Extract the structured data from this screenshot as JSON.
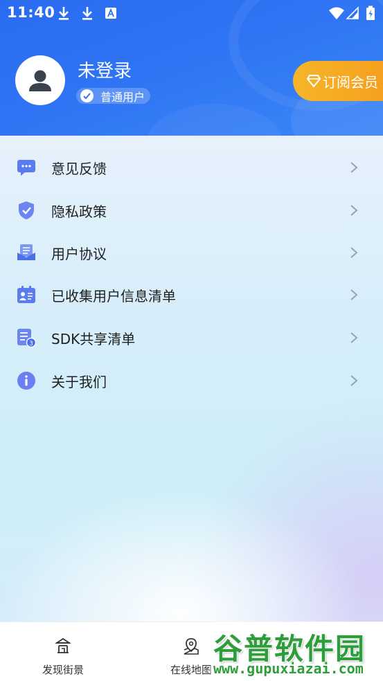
{
  "status_bar": {
    "time": "11:40",
    "icons": [
      "download-icon",
      "download-icon",
      "a-notification-icon",
      "wifi-icon",
      "signal-icon",
      "battery-icon"
    ]
  },
  "profile": {
    "name": "未登录",
    "badge": "普通用户",
    "vip_button": "订阅会员"
  },
  "menu": [
    {
      "label": "意见反馈",
      "icon": "feedback-icon"
    },
    {
      "label": "隐私政策",
      "icon": "shield-icon"
    },
    {
      "label": "用户协议",
      "icon": "agreement-icon"
    },
    {
      "label": "已收集用户信息清单",
      "icon": "id-card-icon"
    },
    {
      "label": "SDK共享清单",
      "icon": "sdk-list-icon"
    },
    {
      "label": "关于我们",
      "icon": "info-icon"
    }
  ],
  "bottom_nav": [
    {
      "label": "发现街景",
      "icon": "pavilion-icon"
    },
    {
      "label": "在线地图",
      "icon": "map-pin-icon"
    }
  ],
  "watermark": {
    "title": "谷普软件园",
    "url": "www.gupuxiazai.com"
  },
  "colors": {
    "header_blue": "#2f74f4",
    "vip_orange": "#f5a623",
    "watermark_green": "#2e9e3b"
  }
}
